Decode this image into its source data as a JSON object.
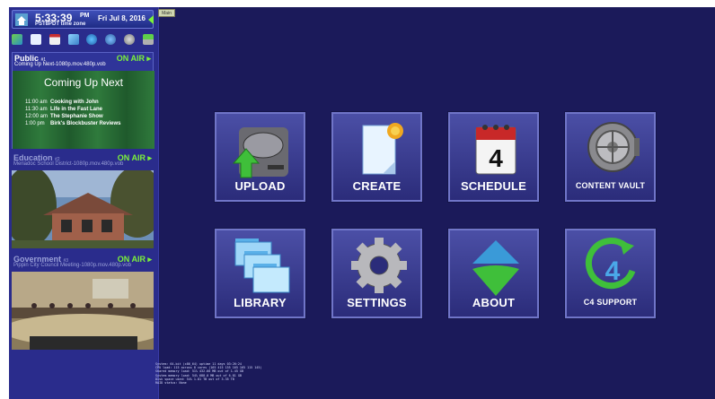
{
  "header": {
    "time": "5:33:39",
    "ampm": "PM",
    "timezone": "PST8PDT time zone",
    "date": "Fri Jul 8, 2016",
    "main_tag": "Main"
  },
  "toolbar_icons": [
    "chart-icon",
    "document-icon",
    "calendar-icon",
    "library-icon",
    "globe-icon",
    "help-icon",
    "settings-icon",
    "upload-icon"
  ],
  "channels": [
    {
      "name": "Public",
      "number": "#1",
      "status": "ON AIR",
      "program": "Coming Up Next-1080p.mov.480p.vob",
      "coming_up": {
        "title": "Coming Up Next",
        "rows": [
          {
            "time": "11:00 am",
            "show": "Cooking with John"
          },
          {
            "time": "11:30 am",
            "show": "Life in the Fast Lane"
          },
          {
            "time": "12:00 am",
            "show": "The Stephanie Show"
          },
          {
            "time": "1:00 pm",
            "show": "Birk's Blockbuster Reviews"
          }
        ]
      }
    },
    {
      "name": "Education",
      "number": "#2",
      "status": "ON AIR",
      "program": "Meriadoc School District-1080p.mov.480p.vob"
    },
    {
      "name": "Government",
      "number": "#3",
      "status": "ON AIR",
      "program": "Pippin City Council Meeting-1080p.mov.480p.vob"
    }
  ],
  "tiles": [
    {
      "label": "UPLOAD",
      "icon": "upload-icon"
    },
    {
      "label": "CREATE",
      "icon": "create-icon"
    },
    {
      "label": "SCHEDULE",
      "icon": "calendar-icon"
    },
    {
      "label": "CONTENT VAULT",
      "icon": "vault-icon"
    },
    {
      "label": "LIBRARY",
      "icon": "folders-icon"
    },
    {
      "label": "SETTINGS",
      "icon": "gear-icon"
    },
    {
      "label": "ABOUT",
      "icon": "about-icon"
    },
    {
      "label": "C4 SUPPORT",
      "icon": "support-icon"
    }
  ],
  "schedule_day": "4",
  "support_digit": "4",
  "status_lines": [
    "System: 64-bit (x86_64) uptime 11 days 03:26:24",
    "CPU load: 115 across 8 cores (165 415 155 165 165 115 145)",
    "Shared memory load: 51%   432.66 MB out of 1.45 GB",
    "System memory load: 54%   688.0 MB out of 6.81 GB",
    "Disk space used: 54%      1.81 TB out of 3.35 TB",
    "RAID status: None"
  ],
  "colors": {
    "background": "#1b1a5a",
    "sidebar": "#2a2c8c",
    "on_air": "#7cf23a",
    "tile_border": "#7075c8"
  }
}
